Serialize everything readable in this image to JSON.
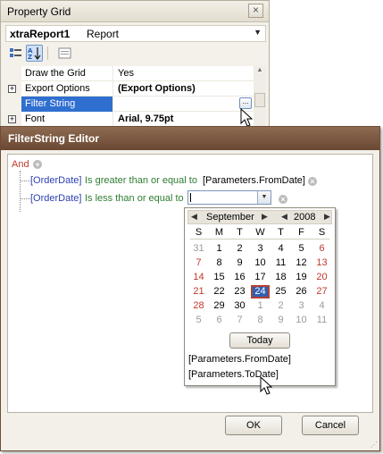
{
  "property_grid": {
    "title": "Property Grid",
    "close_glyph": "×",
    "object_name": "xtraReport1",
    "object_type": "Report",
    "toolbar": {
      "categorized_icon": "categorized-icon",
      "alphabetical_icon": "alphabetical-sort-icon",
      "property_pages_icon": "property-pages-icon"
    },
    "rows": [
      {
        "name": "Draw the Grid",
        "value": "Yes",
        "expandable": false,
        "bold": false,
        "selected": false
      },
      {
        "name": "Export Options",
        "value": "(Export Options)",
        "expandable": true,
        "bold": true,
        "selected": false
      },
      {
        "name": "Filter String",
        "value": "",
        "expandable": false,
        "bold": false,
        "selected": true
      },
      {
        "name": "Font",
        "value": "Arial, 9.75pt",
        "expandable": true,
        "bold": true,
        "selected": false
      }
    ],
    "ellipsis_label": "..."
  },
  "dialog": {
    "title": "FilterString Editor",
    "group_operator": "And",
    "conditions": [
      {
        "field": "[OrderDate]",
        "operator": "Is greater than or equal to",
        "value": "[Parameters.FromDate]"
      },
      {
        "field": "[OrderDate]",
        "operator": "Is less than or equal to",
        "value": ""
      }
    ],
    "ok_label": "OK",
    "cancel_label": "Cancel"
  },
  "calendar": {
    "month": "September",
    "year": "2008",
    "weekdays": [
      "S",
      "M",
      "T",
      "W",
      "T",
      "F",
      "S"
    ],
    "weeks": [
      [
        "31",
        "1",
        "2",
        "3",
        "4",
        "5",
        "6"
      ],
      [
        "7",
        "8",
        "9",
        "10",
        "11",
        "12",
        "13"
      ],
      [
        "14",
        "15",
        "16",
        "17",
        "18",
        "19",
        "20"
      ],
      [
        "21",
        "22",
        "23",
        "24",
        "25",
        "26",
        "27"
      ],
      [
        "28",
        "29",
        "30",
        "1",
        "2",
        "3",
        "4"
      ],
      [
        "5",
        "6",
        "7",
        "8",
        "9",
        "10",
        "11"
      ]
    ],
    "selected_day": "24",
    "today_label": "Today",
    "parameters": [
      "[Parameters.FromDate]",
      "[Parameters.ToDate]"
    ]
  },
  "colors": {
    "group_operator": "#c0392b",
    "field": "#2b3fb0",
    "operator": "#2e7d32",
    "weekend": "#c0392b",
    "selection": "#2f6fd0",
    "dialog_title_bar": "#7a5841"
  }
}
